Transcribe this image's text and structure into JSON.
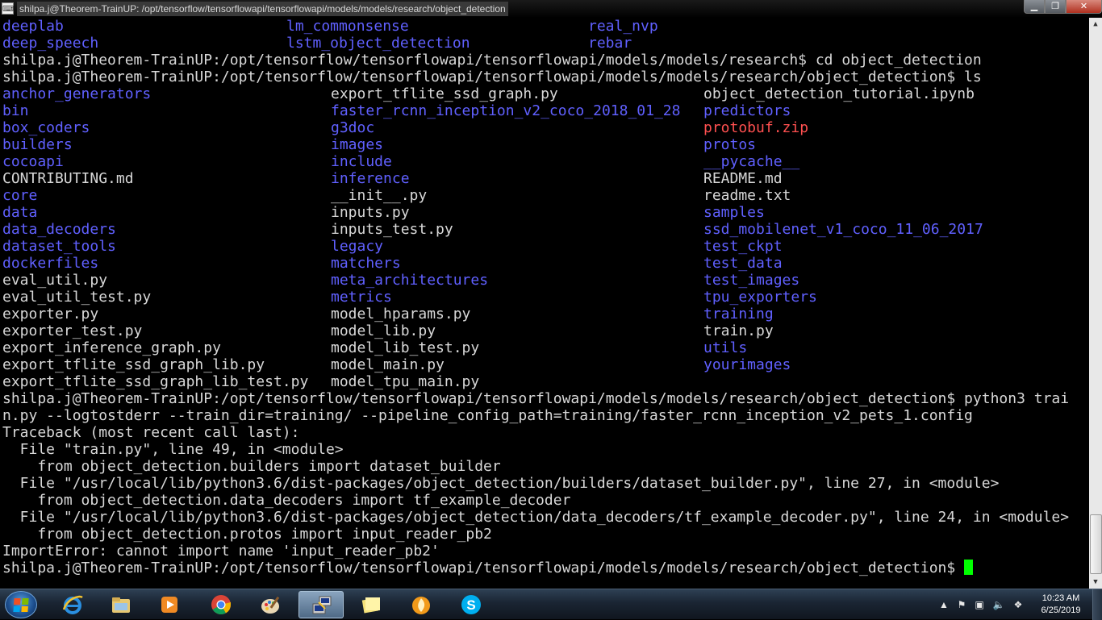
{
  "window": {
    "title": "shilpa.j@Theorem-TrainUP: /opt/tensorflow/tensorflowapi/tensorflowapi/models/models/research/object_detection",
    "icon": "putty-icon",
    "controls": {
      "minimize": "minimize-icon",
      "maximize": "maximize-icon",
      "close": "close-icon"
    }
  },
  "terminal": {
    "colors": {
      "background": "#000000",
      "text": "#d8d8d8",
      "directory": "#6060ff",
      "archive": "#ff5050",
      "cursor": "#00ff00"
    },
    "pre_listing": [
      [
        "deeplab",
        "lm_commonsense",
        "real_nvp"
      ],
      [
        "deep_speech",
        "lstm_object_detection",
        "rebar"
      ]
    ],
    "commands": [
      "shilpa.j@Theorem-TrainUP:/opt/tensorflow/tensorflowapi/tensorflowapi/models/models/research$ cd object_detection",
      "shilpa.j@Theorem-TrainUP:/opt/tensorflow/tensorflowapi/tensorflowapi/models/models/research/object_detection$ ls"
    ],
    "listing": [
      [
        "anchor_generators",
        "export_tflite_ssd_graph.py",
        "object_detection_tutorial.ipynb"
      ],
      [
        "bin",
        "faster_rcnn_inception_v2_coco_2018_01_28",
        "predictors"
      ],
      [
        "box_coders",
        "g3doc",
        "protobuf.zip"
      ],
      [
        "builders",
        "images",
        "protos"
      ],
      [
        "cocoapi",
        "include",
        "__pycache__"
      ],
      [
        "CONTRIBUTING.md",
        "inference",
        "README.md"
      ],
      [
        "core",
        "__init__.py",
        "readme.txt"
      ],
      [
        "data",
        "inputs.py",
        "samples"
      ],
      [
        "data_decoders",
        "inputs_test.py",
        "ssd_mobilenet_v1_coco_11_06_2017"
      ],
      [
        "dataset_tools",
        "legacy",
        "test_ckpt"
      ],
      [
        "dockerfiles",
        "matchers",
        "test_data"
      ],
      [
        "eval_util.py",
        "meta_architectures",
        "test_images"
      ],
      [
        "eval_util_test.py",
        "metrics",
        "tpu_exporters"
      ],
      [
        "exporter.py",
        "model_hparams.py",
        "training"
      ],
      [
        "exporter_test.py",
        "model_lib.py",
        "train.py"
      ],
      [
        "export_inference_graph.py",
        "model_lib_test.py",
        "utils"
      ],
      [
        "export_tflite_ssd_graph_lib.py",
        "model_main.py",
        "yourimages"
      ],
      [
        "export_tflite_ssd_graph_lib_test.py",
        "model_tpu_main.py",
        ""
      ]
    ],
    "directories": [
      "deeplab",
      "deep_speech",
      "lm_commonsense",
      "lstm_object_detection",
      "real_nvp",
      "rebar",
      "anchor_generators",
      "bin",
      "box_coders",
      "builders",
      "cocoapi",
      "core",
      "data",
      "data_decoders",
      "dataset_tools",
      "dockerfiles",
      "faster_rcnn_inception_v2_coco_2018_01_28",
      "g3doc",
      "images",
      "include",
      "inference",
      "legacy",
      "matchers",
      "meta_architectures",
      "metrics",
      "predictors",
      "protos",
      "__pycache__",
      "samples",
      "ssd_mobilenet_v1_coco_11_06_2017",
      "test_ckpt",
      "test_data",
      "test_images",
      "tpu_exporters",
      "training",
      "utils",
      "yourimages"
    ],
    "archives": [
      "protobuf.zip"
    ],
    "output": [
      "shilpa.j@Theorem-TrainUP:/opt/tensorflow/tensorflowapi/tensorflowapi/models/models/research/object_detection$ python3 trai",
      "n.py --logtostderr --train_dir=training/ --pipeline_config_path=training/faster_rcnn_inception_v2_pets_1.config",
      "Traceback (most recent call last):",
      "  File \"train.py\", line 49, in <module>",
      "    from object_detection.builders import dataset_builder",
      "  File \"/usr/local/lib/python3.6/dist-packages/object_detection/builders/dataset_builder.py\", line 27, in <module>",
      "    from object_detection.data_decoders import tf_example_decoder",
      "  File \"/usr/local/lib/python3.6/dist-packages/object_detection/data_decoders/tf_example_decoder.py\", line 24, in <module>",
      "    from object_detection.protos import input_reader_pb2",
      "ImportError: cannot import name 'input_reader_pb2'"
    ],
    "prompt": "shilpa.j@Theorem-TrainUP:/opt/tensorflow/tensorflowapi/tensorflowapi/models/models/research/object_detection$ "
  },
  "taskbar": {
    "start": "windows-start-icon",
    "apps": [
      {
        "icon": "internet-explorer-icon",
        "active": false
      },
      {
        "icon": "file-explorer-icon",
        "active": false
      },
      {
        "icon": "media-player-icon",
        "active": false
      },
      {
        "icon": "chrome-icon",
        "active": false
      },
      {
        "icon": "paint-icon",
        "active": false
      },
      {
        "icon": "putty-icon",
        "active": true
      },
      {
        "icon": "sticky-notes-icon",
        "active": false
      },
      {
        "icon": "burning-app-icon",
        "active": false
      },
      {
        "icon": "skype-icon",
        "active": false
      }
    ],
    "tray": [
      "show-hidden-icons-icon",
      "action-center-flag-icon",
      "network-icon",
      "volume-icon",
      "app-tray-icon"
    ],
    "clock": {
      "time": "10:23 AM",
      "date": "6/25/2019"
    }
  }
}
